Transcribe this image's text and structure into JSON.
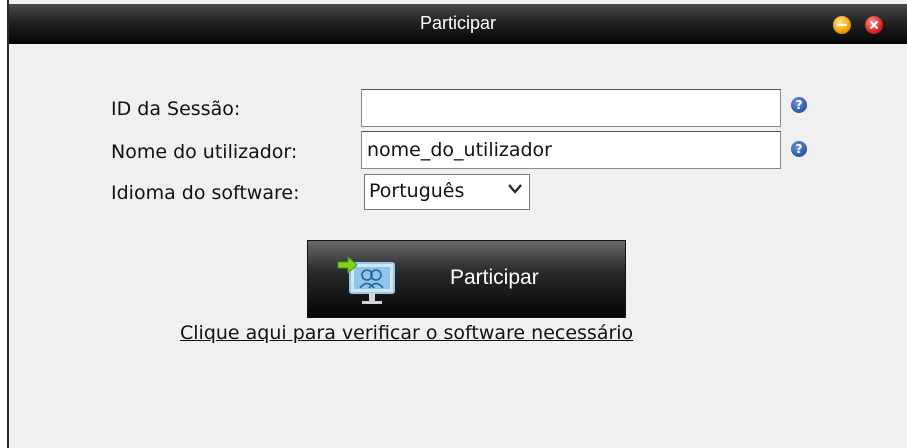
{
  "window": {
    "title": "Participar"
  },
  "form": {
    "session_id": {
      "label": "ID da Sessão:",
      "value": "",
      "help": "?"
    },
    "username": {
      "label": "Nome do utilizador:",
      "value": "nome_do_utilizador",
      "help": "?"
    },
    "language": {
      "label": "Idioma do software:",
      "selected": "Português"
    }
  },
  "actions": {
    "join_label": "Participar",
    "check_software_link": "Clique aqui para verificar o software necessário"
  },
  "colors": {
    "titlebar": "#1a1a1a",
    "window_bg": "#f0f0f0",
    "help_icon": "#2c54a8",
    "minimize": "#f0a800",
    "close": "#e02a2a"
  },
  "icons": [
    "minimize-icon",
    "close-icon",
    "help-icon",
    "chevron-down-icon",
    "join-meeting-icon"
  ]
}
